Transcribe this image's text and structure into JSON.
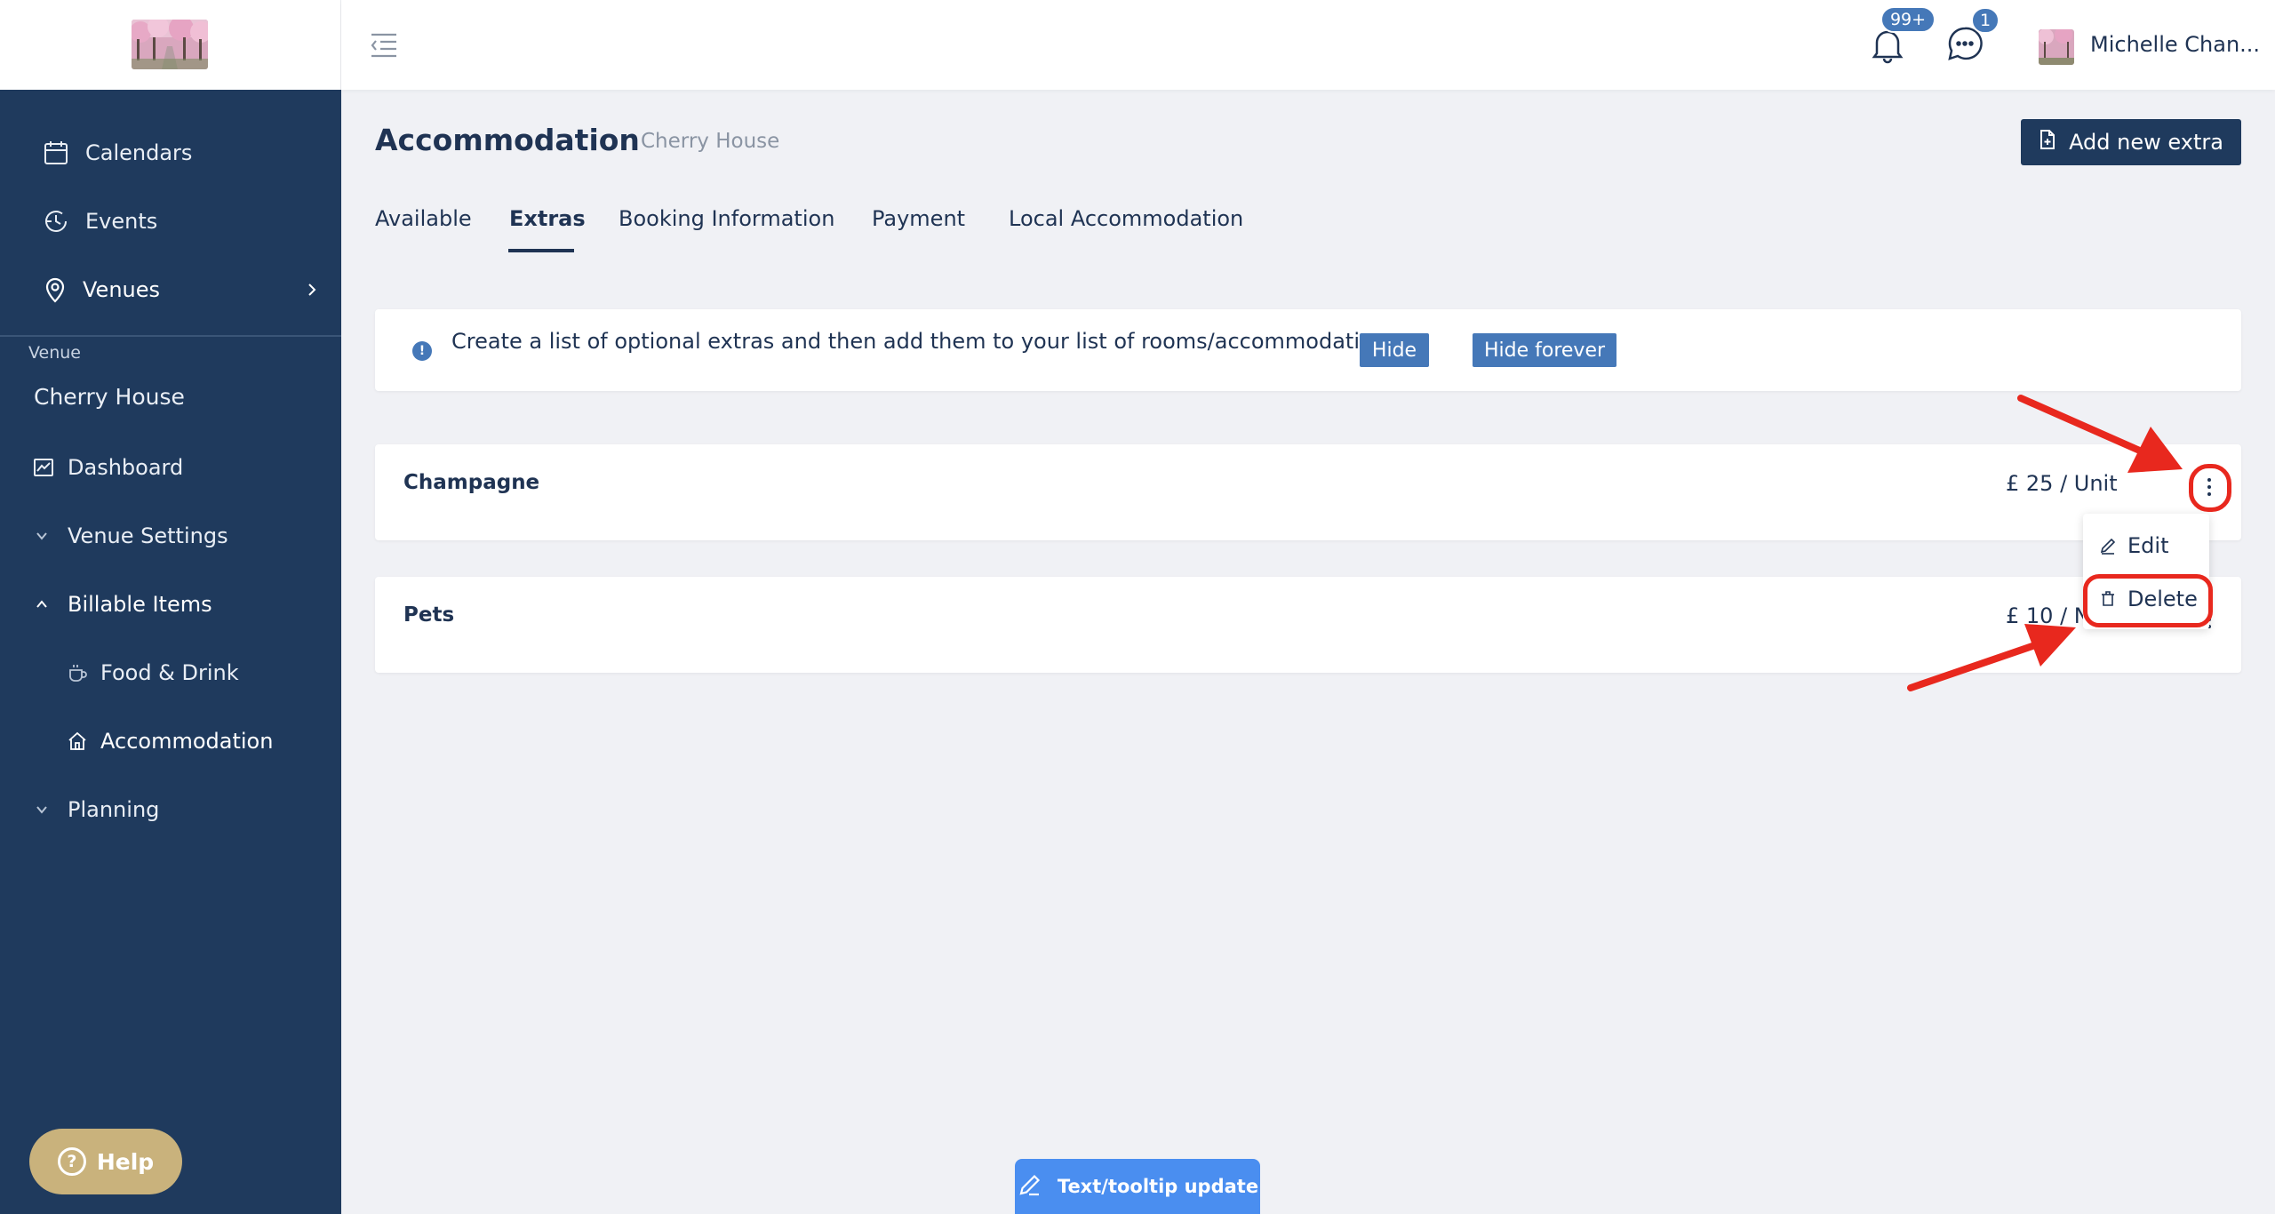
{
  "sidebar": {
    "nav": [
      {
        "label": "Calendars",
        "icon": "calendar-icon"
      },
      {
        "label": "Events",
        "icon": "clock-history-icon"
      },
      {
        "label": "Venues",
        "icon": "map-pin-icon"
      }
    ],
    "section_label": "Venue",
    "venue_name": "Cherry House",
    "venue_nav": [
      {
        "label": "Dashboard",
        "icon": "chart-icon"
      },
      {
        "label": "Venue Settings",
        "icon": "chevron-down-icon"
      },
      {
        "label": "Billable Items",
        "icon": "chevron-up-icon"
      },
      {
        "label": "Food & Drink",
        "icon": "cup-icon"
      },
      {
        "label": "Accommodation",
        "icon": "house-icon"
      },
      {
        "label": "Planning",
        "icon": "chevron-down-icon"
      }
    ],
    "help_label": "Help"
  },
  "topbar": {
    "notifications_badge": "99+",
    "messages_badge": "1",
    "user_name": "Michelle Chan..."
  },
  "page": {
    "title": "Accommodation",
    "subtitle": "Cherry House",
    "add_button_label": "Add new extra",
    "tabs": [
      {
        "label": "Available",
        "active": false
      },
      {
        "label": "Extras",
        "active": true
      },
      {
        "label": "Booking Information",
        "active": false
      },
      {
        "label": "Payment",
        "active": false
      },
      {
        "label": "Local Accommodation",
        "active": false
      }
    ],
    "info": {
      "text": "Create a list of optional extras and then add them to your list of rooms/accommodation",
      "hide_label": "Hide",
      "hide_forever_label": "Hide forever"
    },
    "extras": [
      {
        "name": "Champagne",
        "price": "£ 25 / Unit"
      },
      {
        "name": "Pets",
        "price": "£ 10 / Night"
      }
    ],
    "menu": {
      "edit_label": "Edit",
      "delete_label": "Delete"
    },
    "tooltip_button_label": "Text/tooltip update"
  },
  "colors": {
    "sidebar": "#1f3a5d",
    "accent": "#4578b8",
    "annotation": "#e8281e",
    "help": "#c9b27c",
    "tooltip": "#4a8ef0"
  }
}
